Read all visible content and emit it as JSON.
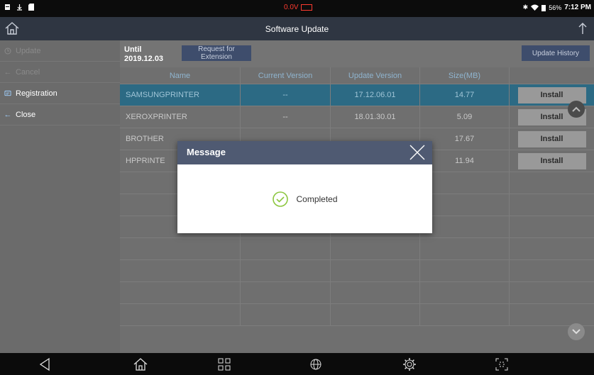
{
  "status_bar": {
    "voltage": "0.0V",
    "battery_percent": "56%",
    "time": "7:12 PM"
  },
  "title_bar": {
    "title": "Software Update"
  },
  "sidebar": {
    "items": [
      {
        "label": "Update",
        "icon": "update-icon",
        "enabled": false
      },
      {
        "label": "Cancel",
        "icon": "back-arrow-icon",
        "enabled": false
      },
      {
        "label": "Registration",
        "icon": "registration-icon",
        "enabled": true
      },
      {
        "label": "Close",
        "icon": "back-arrow-icon",
        "enabled": true
      }
    ]
  },
  "toolbar": {
    "until_label": "Until",
    "until_date": "2019.12.03",
    "extension_button": "Request for Extension",
    "history_button": "Update History"
  },
  "table": {
    "columns": [
      "Name",
      "Current Version",
      "Update Version",
      "Size(MB)",
      ""
    ],
    "rows": [
      {
        "name": "SAMSUNGPRINTER",
        "current": "--",
        "update": "17.12.06.01",
        "size": "14.77",
        "action": "Install",
        "selected": true
      },
      {
        "name": "XEROXPRINTER",
        "current": "--",
        "update": "18.01.30.01",
        "size": "5.09",
        "action": "Install",
        "selected": false
      },
      {
        "name": "BROTHER",
        "current": "",
        "update": "",
        "size": "17.67",
        "action": "Install",
        "selected": false
      },
      {
        "name": "HPPRINTE",
        "current": "",
        "update": "",
        "size": "11.94",
        "action": "Install",
        "selected": false
      }
    ],
    "empty_rows": 7
  },
  "dialog": {
    "title": "Message",
    "message": "Completed"
  },
  "colors": {
    "accent": "#4f5a72",
    "selected_row": "#2c6a84",
    "success": "#8cc63f",
    "warning": "#ff3b30"
  }
}
